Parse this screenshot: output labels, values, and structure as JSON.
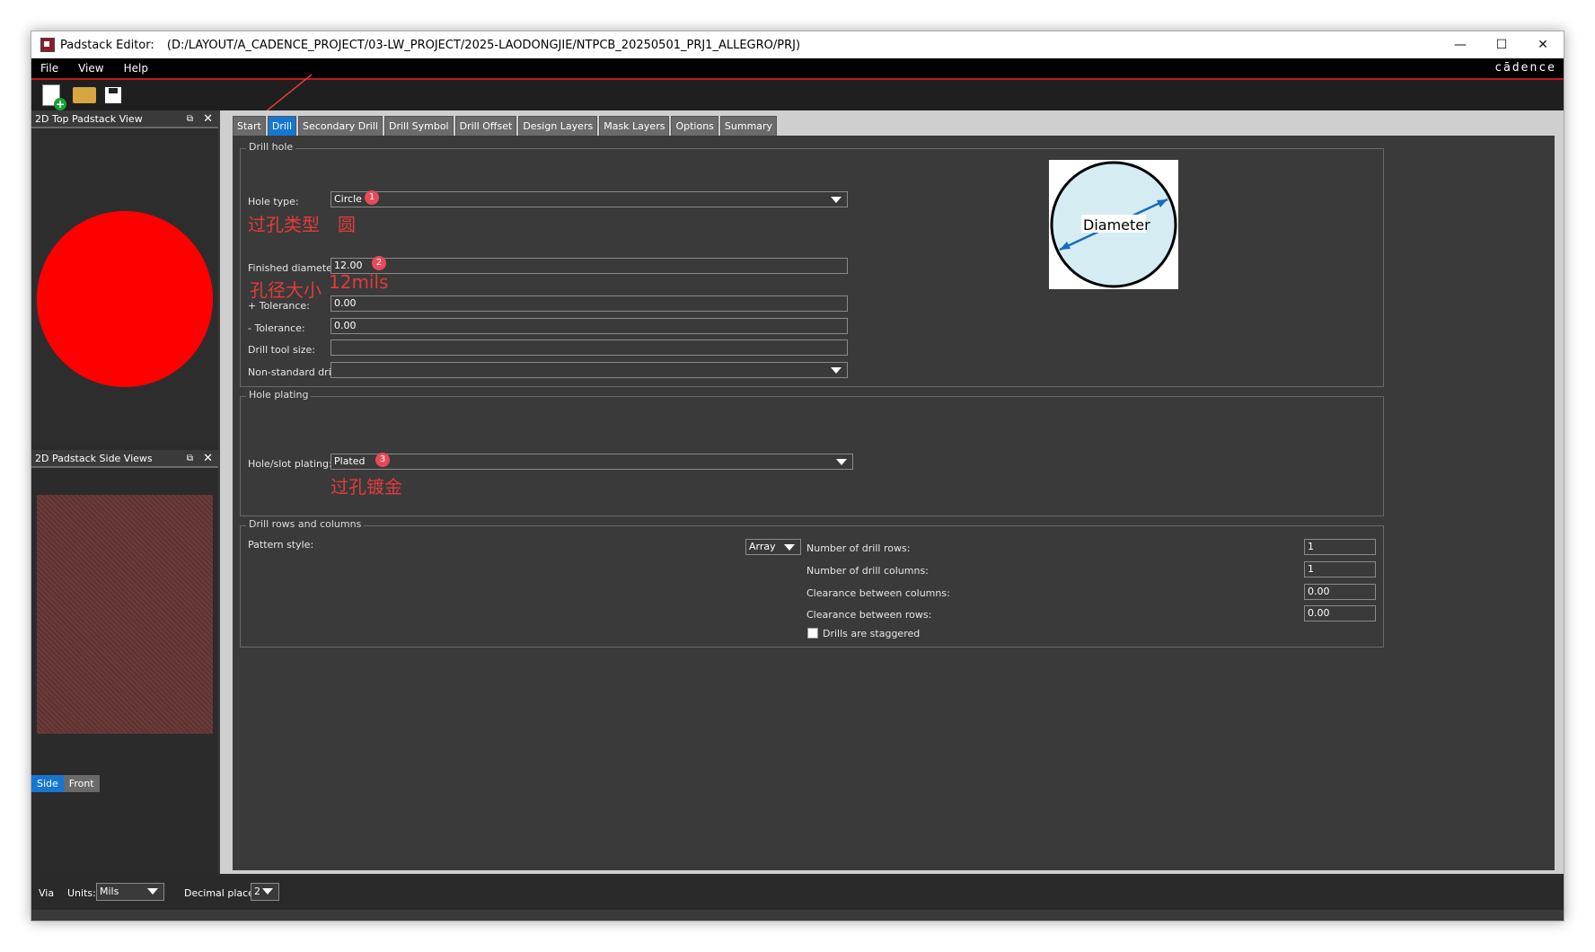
{
  "window": {
    "title": "Padstack Editor:",
    "path": "(D:/LAYOUT/A_CADENCE_PROJECT/03-LW_PROJECT/2025-LAODONGJIE/NTPCB_20250501_PRJ1_ALLEGRO/PRJ)",
    "minimize": "—",
    "maximize": "☐",
    "close": "✕"
  },
  "menu": {
    "file": "File",
    "view": "View",
    "help": "Help",
    "logo": "cādence"
  },
  "left": {
    "top_title": "2D Top Padstack View",
    "side_title": "2D Padstack Side Views",
    "float": "⧉",
    "close": "✕",
    "tab_side": "Side",
    "tab_front": "Front",
    "pad_color": "#ff0000"
  },
  "tabs": [
    "Start",
    "Drill",
    "Secondary Drill",
    "Drill Symbol",
    "Drill Offset",
    "Design Layers",
    "Mask Layers",
    "Options",
    "Summary"
  ],
  "drill_hole": {
    "title": "Drill hole",
    "hole_type_label": "Hole type:",
    "hole_type_value": "Circle",
    "finished_label": "Finished diameter:",
    "finished_value": "12.00",
    "tol_plus_label": "+ Tolerance:",
    "tol_plus_value": "0.00",
    "tol_minus_label": "- Tolerance:",
    "tol_minus_value": "0.00",
    "tool_label": "Drill tool size:",
    "tool_value": "",
    "nonstd_label": "Non-standard drill:",
    "nonstd_value": "",
    "diagram_label": "Diameter"
  },
  "hole_plating": {
    "title": "Hole plating",
    "label": "Hole/slot plating:",
    "value": "Plated"
  },
  "drill_rows": {
    "title": "Drill rows and columns",
    "pattern_label": "Pattern style:",
    "pattern_value": "Array",
    "rows_label": "Number of drill rows:",
    "rows_value": "1",
    "cols_label": "Number of drill columns:",
    "cols_value": "1",
    "clr_cols_label": "Clearance between columns:",
    "clr_cols_value": "0.00",
    "clr_rows_label": "Clearance between rows:",
    "clr_rows_value": "0.00",
    "staggered_label": "Drills are staggered"
  },
  "annotations": {
    "badge1": "1",
    "badge2": "2",
    "badge3": "3",
    "hole_type_cn": "过孔类型",
    "circle_cn": "圆",
    "diameter_cn": "孔径大小",
    "mils": "12mils",
    "plating_cn": "过孔镀金"
  },
  "status": {
    "type": "Via",
    "units_label": "Units:",
    "units_value": "Mils",
    "decimal_label": "Decimal places:",
    "decimal_value": "2"
  }
}
